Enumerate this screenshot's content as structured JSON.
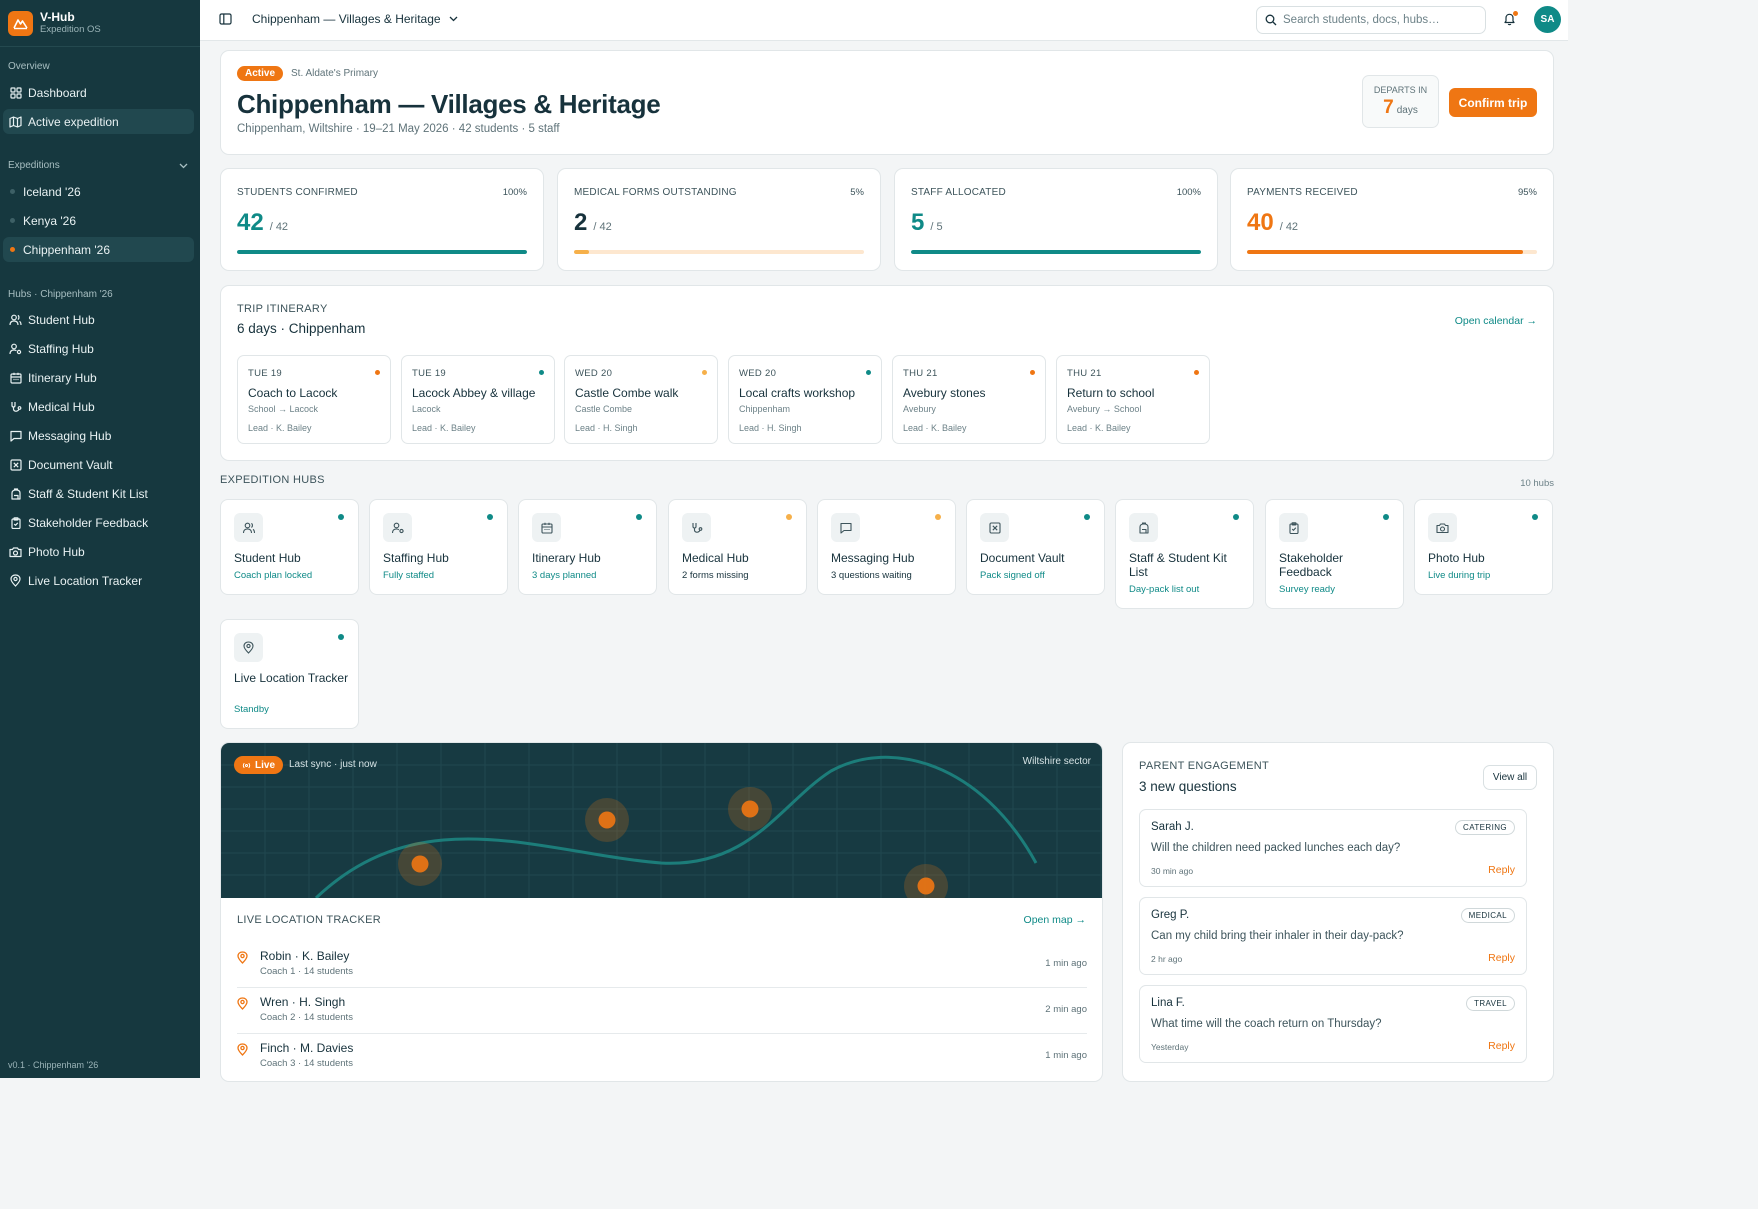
{
  "brand": {
    "name": "V-Hub",
    "subtitle": "Expedition OS"
  },
  "sidebar": {
    "overview_heading": "Overview",
    "overview_items": [
      {
        "label": "Dashboard",
        "icon": "dashboard-icon",
        "active": false
      },
      {
        "label": "Active expedition",
        "icon": "map-icon",
        "active": true
      }
    ],
    "expeditions_heading": "Expeditions",
    "expeditions": [
      {
        "label": "Iceland '26",
        "dot_color": "#3d6066",
        "active": false
      },
      {
        "label": "Kenya '26",
        "dot_color": "#3d6066",
        "active": false
      },
      {
        "label": "Chippenham '26",
        "dot_color": "#ef7613",
        "active": true
      }
    ],
    "hubs_heading": "Hubs · Chippenham '26",
    "hubs": [
      {
        "label": "Student Hub",
        "icon": "users-icon"
      },
      {
        "label": "Staffing Hub",
        "icon": "user-cog-icon"
      },
      {
        "label": "Itinerary Hub",
        "icon": "calendar-icon"
      },
      {
        "label": "Medical Hub",
        "icon": "stethoscope-icon"
      },
      {
        "label": "Messaging Hub",
        "icon": "message-icon"
      },
      {
        "label": "Document Vault",
        "icon": "document-vault-icon"
      },
      {
        "label": "Staff & Student Kit List",
        "icon": "backpack-icon"
      },
      {
        "label": "Stakeholder Feedback",
        "icon": "clipboard-check-icon"
      },
      {
        "label": "Photo Hub",
        "icon": "camera-icon"
      },
      {
        "label": "Live Location Tracker",
        "icon": "location-pin-icon"
      }
    ],
    "footer": "v0.1 · Chippenham '26"
  },
  "topbar": {
    "breadcrumb": "Chippenham — Villages & Heritage",
    "search_placeholder": "Search students, docs, hubs…",
    "avatar_initials": "SA"
  },
  "header": {
    "status": "Active",
    "school": "St. Aldate's Primary",
    "title": "Chippenham — Villages & Heritage",
    "subtitle": "Chippenham, Wiltshire · 19–21 May 2026 · 42 students · 5 staff",
    "departs_label": "DEPARTS IN",
    "departs_value": "7",
    "departs_unit": "days",
    "confirm_label": "Confirm trip"
  },
  "stats": [
    {
      "label": "STUDENTS CONFIRMED",
      "pct_text": "100%",
      "value": "42",
      "denominator": "/ 42",
      "progress": 1.0,
      "value_color": "#0f8a87",
      "bar_color": "#0f8a87",
      "track_color": "#e3eeee"
    },
    {
      "label": "MEDICAL FORMS OUTSTANDING",
      "pct_text": "5%",
      "value": "2",
      "denominator": "/ 42",
      "progress": 0.05,
      "value_color": "#17323c",
      "bar_color": "#f6b04a",
      "track_color": "#fde7cf"
    },
    {
      "label": "STAFF ALLOCATED",
      "pct_text": "100%",
      "value": "5",
      "denominator": "/ 5",
      "progress": 1.0,
      "value_color": "#0f8a87",
      "bar_color": "#0f8a87",
      "track_color": "#e3eeee"
    },
    {
      "label": "PAYMENTS RECEIVED",
      "pct_text": "95%",
      "value": "40",
      "denominator": "/ 42",
      "progress": 0.95,
      "value_color": "#ef7613",
      "bar_color": "#ef7613",
      "track_color": "#fde7cf"
    }
  ],
  "itinerary": {
    "label": "TRIP ITINERARY",
    "title": "6 days · Chippenham",
    "open_calendar": "Open calendar →",
    "days": [
      {
        "date": "TUE 19",
        "title": "Coach to Lacock",
        "location": "School → Lacock",
        "lead": "Lead · K. Bailey",
        "dot_color": "#ef7613"
      },
      {
        "date": "TUE 19",
        "title": "Lacock Abbey & village",
        "location": "Lacock",
        "lead": "Lead · K. Bailey",
        "dot_color": "#0f8a87"
      },
      {
        "date": "WED 20",
        "title": "Castle Combe walk",
        "location": "Castle Combe",
        "lead": "Lead · H. Singh",
        "dot_color": "#f6b04a"
      },
      {
        "date": "WED 20",
        "title": "Local crafts workshop",
        "location": "Chippenham",
        "lead": "Lead · H. Singh",
        "dot_color": "#0f8a87"
      },
      {
        "date": "THU 21",
        "title": "Avebury stones",
        "location": "Avebury",
        "lead": "Lead · K. Bailey",
        "dot_color": "#ef7613"
      },
      {
        "date": "THU 21",
        "title": "Return to school",
        "location": "Avebury → School",
        "lead": "Lead · K. Bailey",
        "dot_color": "#ef7613"
      }
    ]
  },
  "hubs_section": {
    "heading": "EXPEDITION HUBS",
    "count": "10 hubs",
    "hubs": [
      {
        "name": "Student Hub",
        "status": "Coach plan locked",
        "status_color": "#0f8a87",
        "dot_color": "#0f8a87",
        "icon": "users-icon"
      },
      {
        "name": "Staffing Hub",
        "status": "Fully staffed",
        "status_color": "#0f8a87",
        "dot_color": "#0f8a87",
        "icon": "user-cog-icon"
      },
      {
        "name": "Itinerary Hub",
        "status": "3 days planned",
        "status_color": "#0f8a87",
        "dot_color": "#0f8a87",
        "icon": "calendar-icon"
      },
      {
        "name": "Medical Hub",
        "status": "2 forms missing",
        "status_color": "#17323c",
        "dot_color": "#f6b04a",
        "icon": "stethoscope-icon"
      },
      {
        "name": "Messaging Hub",
        "status": "3 questions waiting",
        "status_color": "#17323c",
        "dot_color": "#f6b04a",
        "icon": "message-icon"
      },
      {
        "name": "Document Vault",
        "status": "Pack signed off",
        "status_color": "#0f8a87",
        "dot_color": "#0f8a87",
        "icon": "document-vault-icon"
      },
      {
        "name": "Staff & Student Kit List",
        "status": "Day-pack list out",
        "status_color": "#0f8a87",
        "dot_color": "#0f8a87",
        "icon": "backpack-icon"
      },
      {
        "name": "Stakeholder Feedback",
        "status": "Survey ready",
        "status_color": "#0f8a87",
        "dot_color": "#0f8a87",
        "icon": "clipboard-check-icon"
      },
      {
        "name": "Photo Hub",
        "status": "Live during trip",
        "status_color": "#0f8a87",
        "dot_color": "#0f8a87",
        "icon": "camera-icon"
      },
      {
        "name": "Live Location Tracker",
        "status": "Standby",
        "status_color": "#0f8a87",
        "dot_color": "#0f8a87",
        "icon": "location-pin-icon"
      }
    ]
  },
  "map": {
    "live_label": "Live",
    "last_sync": "Last sync · just now",
    "sector": "Wiltshire sector"
  },
  "tracker": {
    "heading": "LIVE LOCATION TRACKER",
    "open_map": "Open map →",
    "groups": [
      {
        "name": "Robin · K. Bailey",
        "detail": "Coach 1 · 14 students",
        "time": "1 min ago"
      },
      {
        "name": "Wren · H. Singh",
        "detail": "Coach 2 · 14 students",
        "time": "2 min ago"
      },
      {
        "name": "Finch · M. Davies",
        "detail": "Coach 3 · 14 students",
        "time": "1 min ago"
      }
    ]
  },
  "engagement": {
    "label": "PARENT ENGAGEMENT",
    "title": "3 new questions",
    "view_all": "View all",
    "questions": [
      {
        "name": "Sarah J.",
        "tag": "CATERING",
        "text": "Will the children need packed lunches each day?",
        "time": "30 min ago",
        "reply": "Reply"
      },
      {
        "name": "Greg P.",
        "tag": "MEDICAL",
        "text": "Can my child bring their inhaler in their day-pack?",
        "time": "2 hr ago",
        "reply": "Reply"
      },
      {
        "name": "Lina F.",
        "tag": "TRAVEL",
        "text": "What time will the coach return on Thursday?",
        "time": "Yesterday",
        "reply": "Reply"
      }
    ]
  },
  "colors": {
    "accent": "#ef7613",
    "teal": "#0f8a87",
    "sidebar": "#16383f",
    "amber": "#f6b04a"
  }
}
